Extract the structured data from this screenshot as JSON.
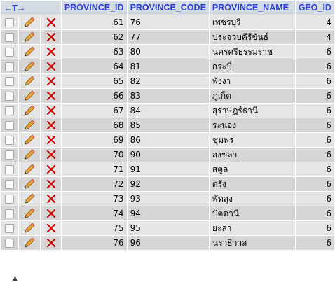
{
  "header": {
    "arrows": "←T→",
    "columns": [
      "PROVINCE_ID",
      "PROVINCE_CODE",
      "PROVINCE_NAME",
      "GEO_ID"
    ]
  },
  "rows": [
    {
      "id": "61",
      "code": "76",
      "name": "เพชรบุรี",
      "geo": "4"
    },
    {
      "id": "62",
      "code": "77",
      "name": "ประจวบคีรีขันธ์",
      "geo": "4"
    },
    {
      "id": "63",
      "code": "80",
      "name": "นครศรีธรรมราช",
      "geo": "6"
    },
    {
      "id": "64",
      "code": "81",
      "name": "กระบี่",
      "geo": "6"
    },
    {
      "id": "65",
      "code": "82",
      "name": "พังงา",
      "geo": "6"
    },
    {
      "id": "66",
      "code": "83",
      "name": "ภูเก็ต",
      "geo": "6"
    },
    {
      "id": "67",
      "code": "84",
      "name": "สุราษฎร์ธานี",
      "geo": "6"
    },
    {
      "id": "68",
      "code": "85",
      "name": "ระนอง",
      "geo": "6"
    },
    {
      "id": "69",
      "code": "86",
      "name": "ชุมพร",
      "geo": "6"
    },
    {
      "id": "70",
      "code": "90",
      "name": "สงขลา",
      "geo": "6"
    },
    {
      "id": "71",
      "code": "91",
      "name": "สตูล",
      "geo": "6"
    },
    {
      "id": "72",
      "code": "92",
      "name": "ตรัง",
      "geo": "6"
    },
    {
      "id": "73",
      "code": "93",
      "name": "พัทลุง",
      "geo": "6"
    },
    {
      "id": "74",
      "code": "94",
      "name": "ปัตตานี",
      "geo": "6"
    },
    {
      "id": "75",
      "code": "95",
      "name": "ยะลา",
      "geo": "6"
    },
    {
      "id": "76",
      "code": "96",
      "name": "นราธิวาส",
      "geo": "6"
    }
  ],
  "icons": {
    "edit": "pencil-icon",
    "delete": "delete-x-icon"
  },
  "colors": {
    "header_bg": "#d3dce3",
    "header_text": "#2a3edb",
    "row_odd": "#e5e5e5",
    "row_even": "#d5d5d5",
    "delete": "#cc0000"
  }
}
